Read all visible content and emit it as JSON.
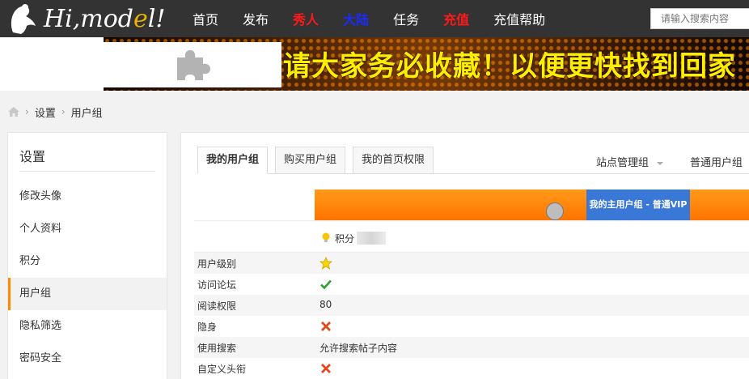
{
  "logo": {
    "text_a": "Hi",
    "text_b": ",mod",
    "text_c": "e",
    "text_d": "l!"
  },
  "nav": {
    "items": [
      {
        "label": "首页",
        "style": "normal"
      },
      {
        "label": "发布",
        "style": "normal"
      },
      {
        "label": "秀人",
        "style": "red"
      },
      {
        "label": "大陆",
        "style": "blue"
      },
      {
        "label": "任务",
        "style": "normal"
      },
      {
        "label": "充值",
        "style": "red"
      },
      {
        "label": "充值帮助",
        "style": "normal"
      }
    ],
    "search_placeholder": "请输入搜索内容"
  },
  "banner": {
    "text": "请大家务必收藏！以便更快找到回家",
    "plugin_icon": "puzzle-icon"
  },
  "breadcrumb": {
    "home_icon": "home-icon",
    "items": [
      "设置",
      "用户组"
    ]
  },
  "sidebar": {
    "title": "设置",
    "items": [
      "修改头像",
      "个人资料",
      "积分",
      "用户组",
      "隐私筛选",
      "密码安全"
    ],
    "active_index": 3
  },
  "main": {
    "tabs": [
      "我的用户组",
      "购买用户组",
      "我的首页权限"
    ],
    "active_tab": 0,
    "group_selectors": [
      "站点管理组",
      "普通用户组"
    ],
    "primary_group_label": "我的主用户组 - 普通VIP",
    "points_label": "积分",
    "permissions": [
      {
        "key": "用户级别",
        "icon": "star-icon",
        "value": ""
      },
      {
        "key": "访问论坛",
        "icon": "check-icon",
        "value": ""
      },
      {
        "key": "阅读权限",
        "icon": "",
        "value": "80"
      },
      {
        "key": "隐身",
        "icon": "cross-icon",
        "value": ""
      },
      {
        "key": "使用搜索",
        "icon": "",
        "value": "允许搜索帖子内容"
      },
      {
        "key": "自定义头衔",
        "icon": "cross-icon",
        "value": ""
      }
    ]
  },
  "colors": {
    "accent": "#ff8a00",
    "topbar": "#333333",
    "primary_group_bg": "#3a78d8",
    "banner_text": "#ffee00"
  }
}
